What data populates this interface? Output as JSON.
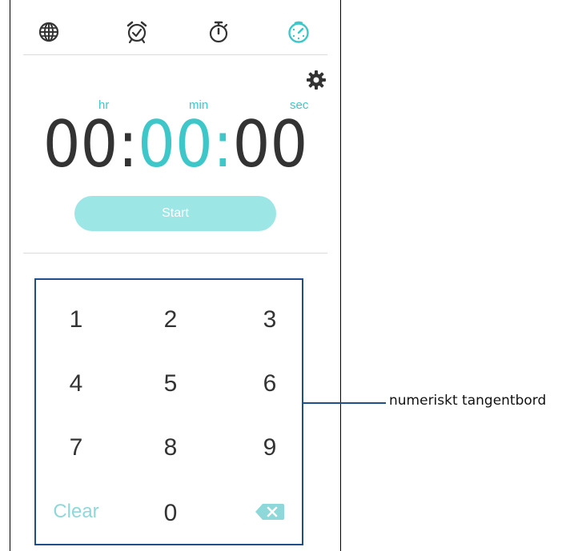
{
  "tabs": [
    {
      "icon": "globe-icon"
    },
    {
      "icon": "alarm-clock-icon"
    },
    {
      "icon": "stopwatch-icon"
    },
    {
      "icon": "timer-icon",
      "active": true
    }
  ],
  "colors": {
    "accent": "#3ec7c9",
    "start_button": "#9de6e6",
    "text": "#333333",
    "callout": "#1f4e8c"
  },
  "settings_icon": "gear-icon",
  "units": {
    "hr": "hr",
    "min": "min",
    "sec": "sec"
  },
  "time": {
    "hours": "00",
    "sep1": ":",
    "minutes": "00",
    "sep2": ":",
    "seconds": "00"
  },
  "start_label": "Start",
  "keypad": {
    "k1": "1",
    "k2": "2",
    "k3": "3",
    "k4": "4",
    "k5": "5",
    "k6": "6",
    "k7": "7",
    "k8": "8",
    "k9": "9",
    "clear": "Clear",
    "k0": "0",
    "backspace_icon": "backspace-icon"
  },
  "callout": "numeriskt tangentbord"
}
